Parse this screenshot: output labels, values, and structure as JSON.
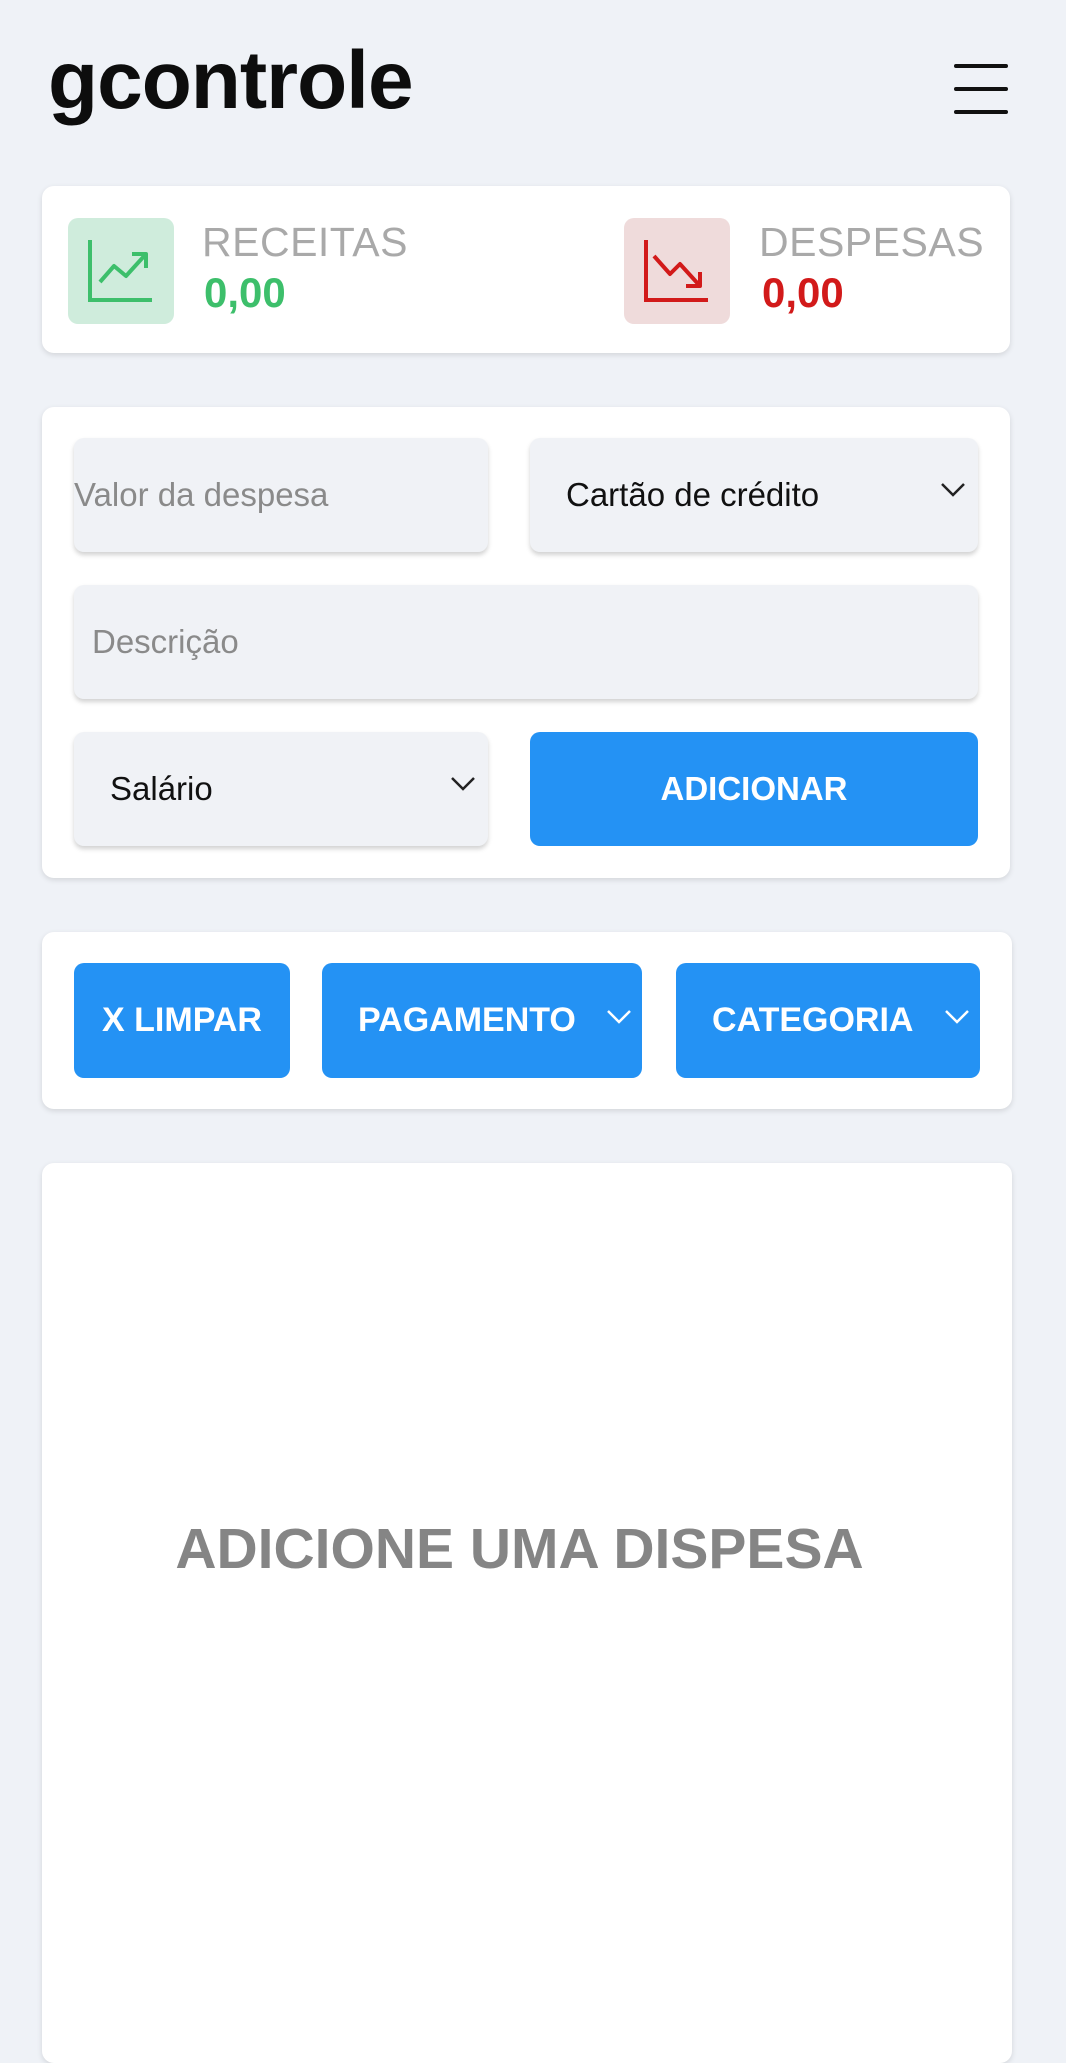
{
  "header": {
    "title": "gcontrole",
    "menu_icon": "hamburger-menu-icon"
  },
  "summary": {
    "income": {
      "label": "RECEITAS",
      "value": "0,00",
      "icon": "trending-up-icon",
      "color": "#3dbf6b"
    },
    "expense": {
      "label": "DESPESAS",
      "value": "0,00",
      "icon": "trending-down-icon",
      "color": "#d21a1a"
    }
  },
  "form": {
    "value_placeholder": "Valor da despesa",
    "payment_selected": "Cartão de crédito",
    "description_placeholder": "Descrição",
    "category_selected": "Salário",
    "add_label": "ADICIONAR"
  },
  "filters": {
    "clear_label": "X LIMPAR",
    "payment_label": "PAGAMENTO",
    "category_label": "CATEGORIA"
  },
  "list": {
    "empty_message": "ADICIONE UMA DISPESA"
  },
  "colors": {
    "accent": "#2492f4",
    "background": "#eff2f7"
  }
}
